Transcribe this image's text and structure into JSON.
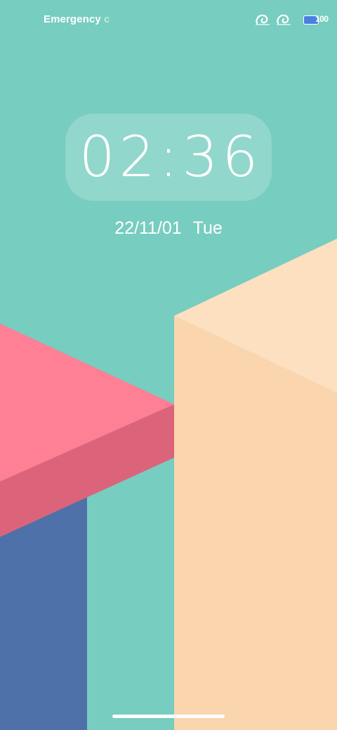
{
  "status_bar": {
    "carrier_text": "Emergency",
    "carrier_overflow": "c",
    "signal_icons": [
      "wifi-call-icon",
      "wifi-call-icon"
    ],
    "battery_level_percent": 100,
    "battery_text": "100",
    "battery_color": "#4a7fe0"
  },
  "lock_screen": {
    "time": "02:36",
    "date": "22/11/01",
    "weekday": "Tue"
  },
  "wallpaper": {
    "background_color": "#77cdc0",
    "pink_color": "#ff7f95",
    "pink_dark_color": "#db647b",
    "blue_color": "#4d71a8",
    "peach_color": "#fad5ae",
    "peach_light_color": "#fde0c0"
  }
}
